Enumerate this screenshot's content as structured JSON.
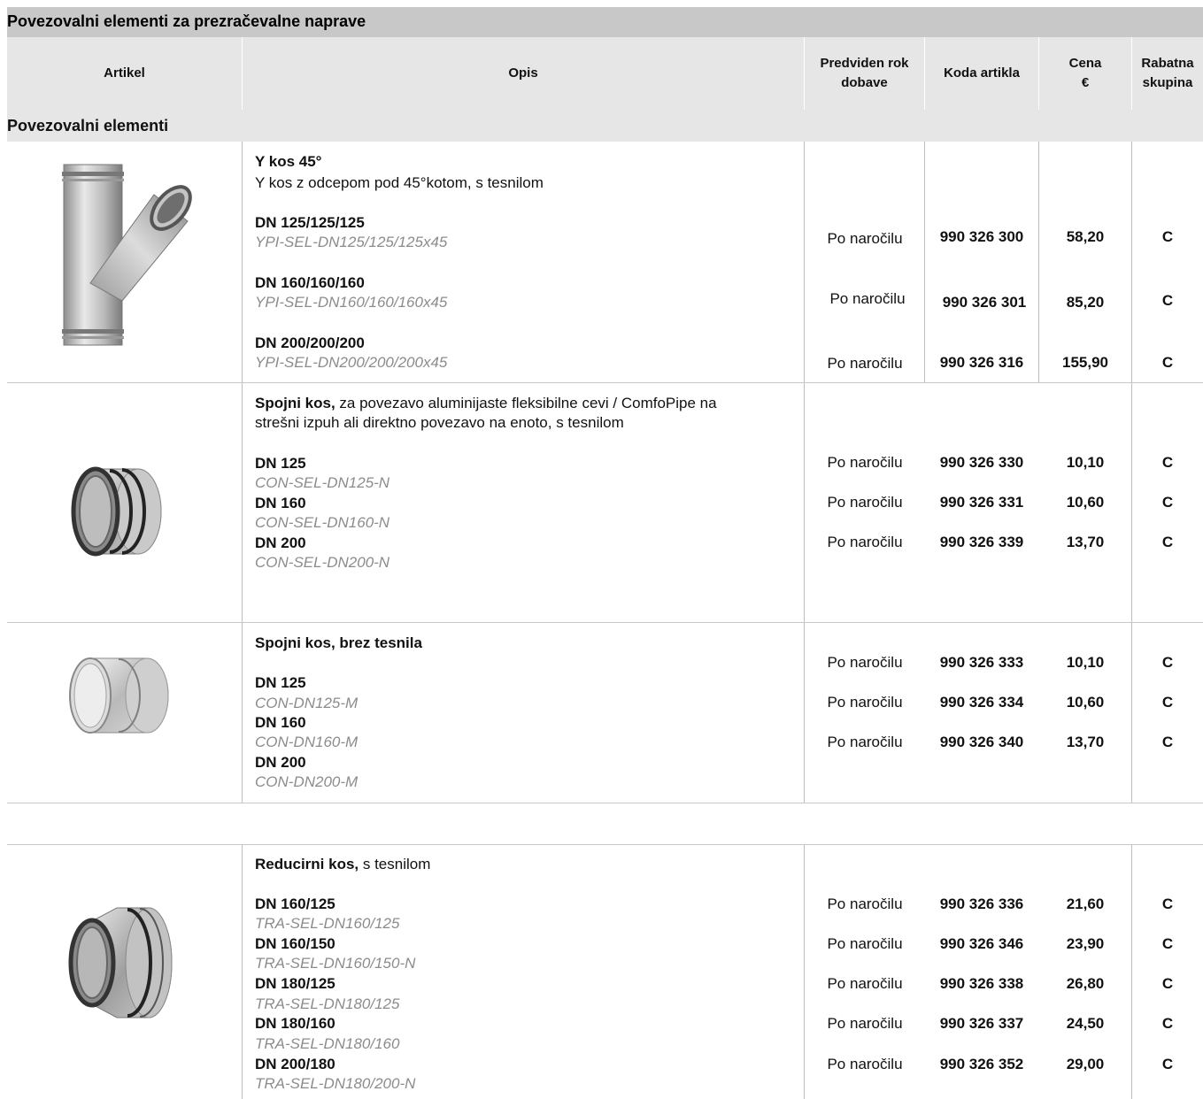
{
  "title": "Povezovalni elementi za prezračevalne naprave",
  "headers": {
    "artikel": "Artikel",
    "opis": "Opis",
    "rok_line1": "Predviden rok",
    "rok_line2": "dobave",
    "koda": "Koda artikla",
    "cena_line1": "Cena",
    "cena_line2": "€",
    "rabat_line1": "Rabatna",
    "rabat_line2": "skupina"
  },
  "section": "Povezovalni elementi",
  "products": [
    {
      "name": "Y kos 45°",
      "desc": "Y kos z odcepom pod 45°kotom, s tesnilom",
      "image_icon": "y-piece-45-icon",
      "variants": [
        {
          "dn": "DN 125/125/125",
          "code": "YPI-SEL-DN125/125/125x45",
          "rok": "Po naročilu",
          "koda": "990 326 300",
          "cena": "58,20",
          "rabat": "C"
        },
        {
          "dn": "DN 160/160/160",
          "code": "YPI-SEL-DN160/160/160x45",
          "rok": "Po naročilu",
          "koda": "990 326 301",
          "cena": "85,20",
          "rabat": "C"
        },
        {
          "dn": "DN 200/200/200",
          "code": "YPI-SEL-DN200/200/200x45",
          "rok": "Po naročilu",
          "koda": "990 326 316",
          "cena": "155,90",
          "rabat": "C"
        }
      ]
    },
    {
      "name": "Spojni kos,",
      "desc_line1": " za povezavo aluminijaste fleksibilne cevi / ComfoPipe na",
      "desc_line2": "strešni izpuh ali direktno povezavo na enoto, s tesnilom",
      "image_icon": "connector-with-seal-icon",
      "variants": [
        {
          "dn": "DN 125",
          "code": "CON-SEL-DN125-N",
          "rok": "Po naročilu",
          "koda": "990 326 330",
          "cena": "10,10",
          "rabat": "C"
        },
        {
          "dn": "DN 160",
          "code": "CON-SEL-DN160-N",
          "rok": "Po naročilu",
          "koda": "990 326 331",
          "cena": "10,60",
          "rabat": "C"
        },
        {
          "dn": "DN 200",
          "code": "CON-SEL-DN200-N",
          "rok": "Po naročilu",
          "koda": "990 326 339",
          "cena": "13,70",
          "rabat": "C"
        }
      ]
    },
    {
      "name": "Spojni kos, brez tesnila",
      "image_icon": "connector-no-seal-icon",
      "variants": [
        {
          "dn": "DN 125",
          "code": "CON-DN125-M",
          "rok": "Po naročilu",
          "koda": "990 326 333",
          "cena": "10,10",
          "rabat": "C"
        },
        {
          "dn": "DN 160",
          "code": "CON-DN160-M",
          "rok": "Po naročilu",
          "koda": "990 326 334",
          "cena": "10,60",
          "rabat": "C"
        },
        {
          "dn": "DN 200",
          "code": "CON-DN200-M",
          "rok": "Po naročilu",
          "koda": "990 326 340",
          "cena": "13,70",
          "rabat": "C"
        }
      ]
    },
    {
      "name": "Reducirni kos,",
      "desc": " s tesnilom",
      "image_icon": "reducer-icon",
      "variants": [
        {
          "dn": "DN 160/125",
          "code": "TRA-SEL-DN160/125",
          "rok": "Po naročilu",
          "koda": "990 326 336",
          "cena": "21,60",
          "rabat": "C"
        },
        {
          "dn": "DN 160/150",
          "code": "TRA-SEL-DN160/150-N",
          "rok": "Po naročilu",
          "koda": "990 326 346",
          "cena": "23,90",
          "rabat": "C"
        },
        {
          "dn": "DN 180/125",
          "code": "TRA-SEL-DN180/125",
          "rok": "Po naročilu",
          "koda": "990 326 338",
          "cena": "26,80",
          "rabat": "C"
        },
        {
          "dn": "DN 180/160",
          "code": "TRA-SEL-DN180/160",
          "rok": "Po naročilu",
          "koda": "990 326 337",
          "cena": "24,50",
          "rabat": "C"
        },
        {
          "dn": "DN 200/180",
          "code": "TRA-SEL-DN180/200-N",
          "rok": "Po naročilu",
          "koda": "990 326 352",
          "cena": "29,00",
          "rabat": "C"
        }
      ]
    }
  ]
}
